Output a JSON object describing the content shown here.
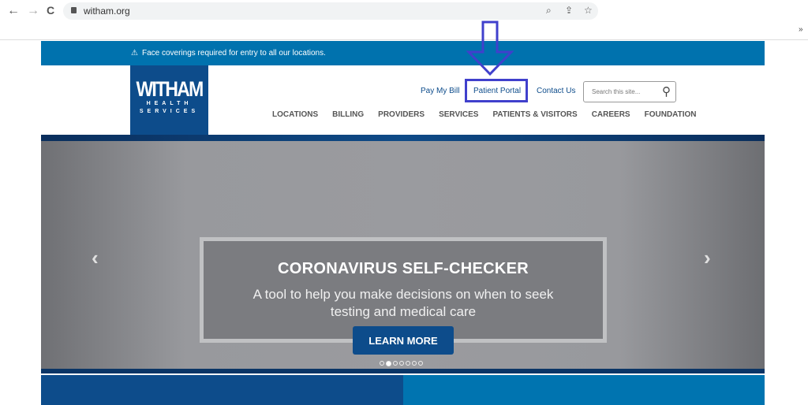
{
  "browser": {
    "url": "witham.org",
    "back": "←",
    "forward": "→",
    "reload": "C",
    "more": "»"
  },
  "alert": {
    "icon": "warning-icon",
    "text": "Face coverings required for entry to all our locations."
  },
  "logo": {
    "word": "WITHAM",
    "line1": "HEALTH",
    "line2": "SERVICES"
  },
  "utility_nav": [
    "Pay My Bill",
    "Patient Portal",
    "Contact Us"
  ],
  "search": {
    "placeholder": "Search this site..."
  },
  "main_nav": [
    "LOCATIONS",
    "BILLING",
    "PROVIDERS",
    "SERVICES",
    "PATIENTS & VISITORS",
    "CAREERS",
    "FOUNDATION"
  ],
  "hero": {
    "title": "CORONAVIRUS SELF-CHECKER",
    "text": "A tool to help you make decisions on when to seek testing and medical care",
    "button": "LEARN MORE",
    "prev": "‹",
    "next": "›",
    "slide_count": 7,
    "active_slide": 2
  },
  "colors": {
    "brand": "#0d4c8b",
    "alert": "#0072ae",
    "annotation": "#4040cc"
  }
}
